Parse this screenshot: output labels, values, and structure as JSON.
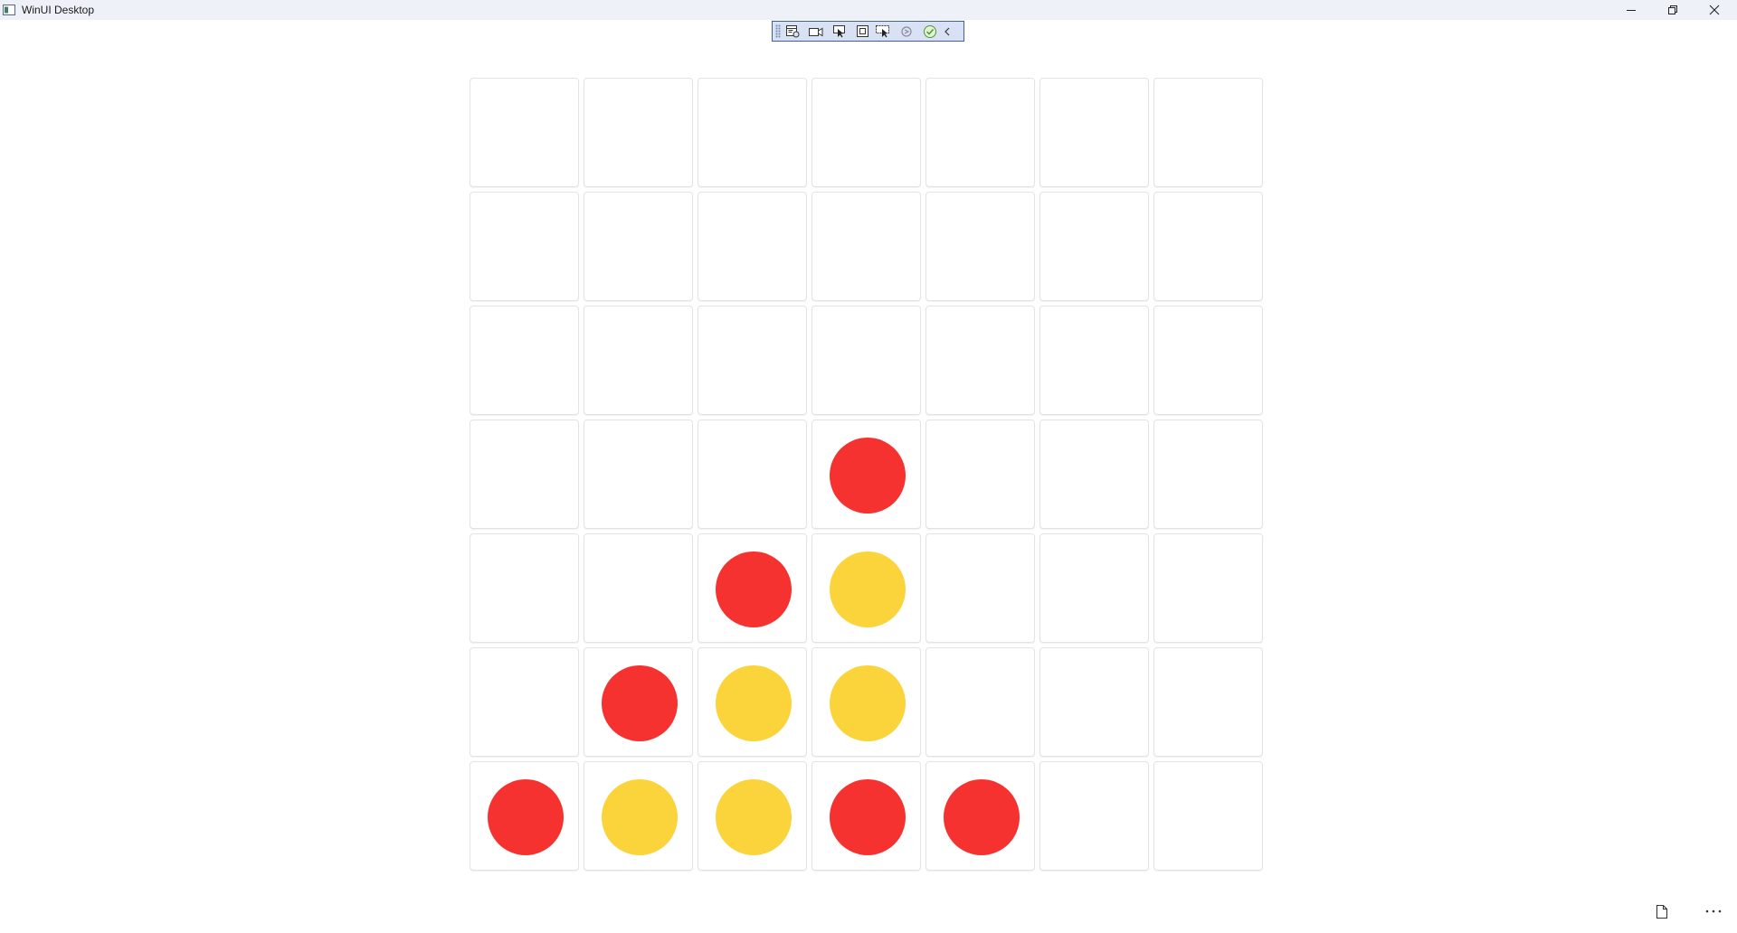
{
  "window": {
    "title": "WinUI Desktop"
  },
  "title_bar_buttons": [
    "minimize",
    "restore",
    "close"
  ],
  "debug_toolbar": {
    "tools": [
      "live-visual-tree-icon",
      "record-icon",
      "select-element-icon",
      "display-layout-adorners-icon",
      "track-focus-icon",
      "hot-reload-icon",
      "accessibility-check-icon",
      "collapse-chevron-icon"
    ]
  },
  "game": {
    "columns": 7,
    "rows": 7,
    "colors": {
      "red": "#f53230",
      "yellow": "#fbd33b",
      "cell_border": "#e3e3e3"
    },
    "board": [
      [
        "",
        "",
        "",
        "",
        "",
        "",
        ""
      ],
      [
        "",
        "",
        "",
        "",
        "",
        "",
        ""
      ],
      [
        "",
        "",
        "",
        "",
        "",
        "",
        ""
      ],
      [
        "",
        "",
        "",
        "red",
        "",
        "",
        ""
      ],
      [
        "",
        "",
        "red",
        "yellow",
        "",
        "",
        ""
      ],
      [
        "",
        "red",
        "yellow",
        "yellow",
        "",
        "",
        ""
      ],
      [
        "red",
        "yellow",
        "yellow",
        "red",
        "red",
        "",
        ""
      ]
    ]
  },
  "bottom_bar": {
    "buttons": [
      "document-icon",
      "more-options-icon"
    ]
  }
}
